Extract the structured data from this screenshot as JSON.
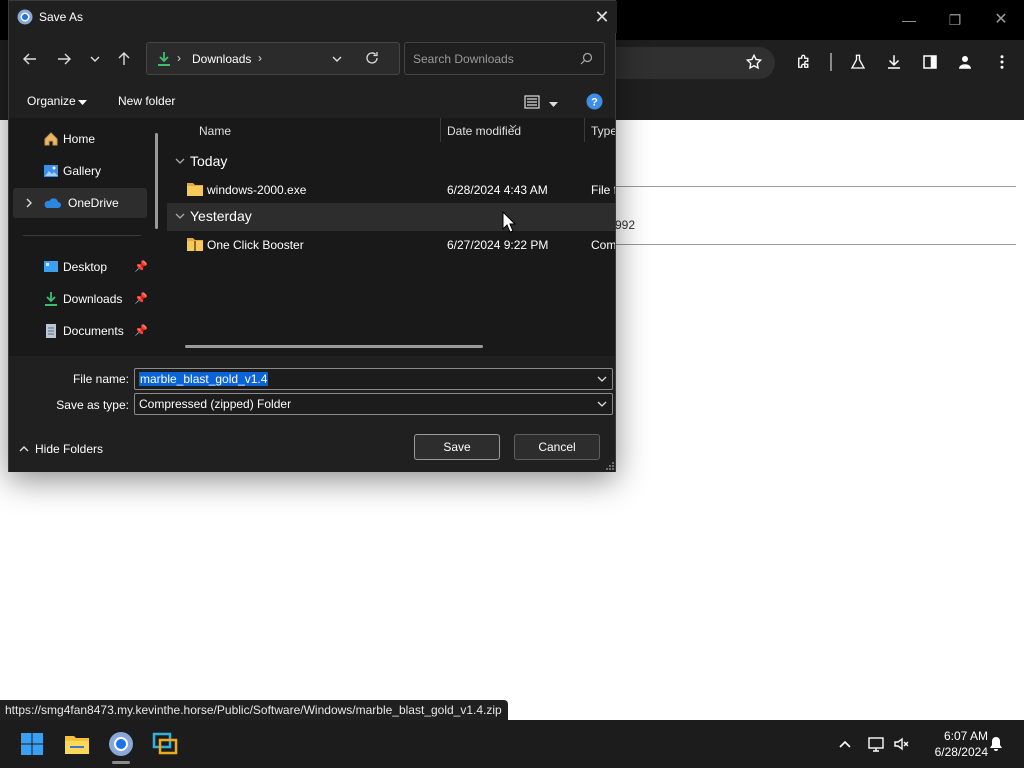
{
  "browser": {
    "status_url": "https://smg4fan8473.my.kevinthe.horse/Public/Software/Windows/marble_blast_gold_v1.4.zip",
    "page_partial_text": "992",
    "toolbar_icons": [
      "star-icon",
      "extensions-icon",
      "labs-icon",
      "download-icon",
      "sidepanel-icon",
      "profile-icon",
      "more-icon"
    ]
  },
  "dialog": {
    "title": "Save As",
    "address": {
      "location": "Downloads"
    },
    "search": {
      "placeholder": "Search Downloads"
    },
    "commands": {
      "organize": "Organize",
      "new_folder": "New folder"
    },
    "nav_pane": {
      "items": [
        {
          "label": "Home",
          "icon": "home-icon"
        },
        {
          "label": "Gallery",
          "icon": "gallery-icon"
        },
        {
          "label": "OneDrive",
          "icon": "onedrive-icon",
          "selected": true
        },
        {
          "label": "Desktop",
          "icon": "desktop-icon",
          "pinned": true
        },
        {
          "label": "Downloads",
          "icon": "downloads-icon",
          "pinned": true
        },
        {
          "label": "Documents",
          "icon": "documents-icon",
          "pinned": true
        }
      ]
    },
    "columns": {
      "name": "Name",
      "date": "Date modified",
      "type": "Type"
    },
    "groups": [
      {
        "label": "Today",
        "files": [
          {
            "name": "windows-2000.exe",
            "date": "6/28/2024 4:43 AM",
            "type": "File fo"
          }
        ]
      },
      {
        "label": "Yesterday",
        "files": [
          {
            "name": "One Click Booster",
            "date": "6/27/2024 9:22 PM",
            "type": "Com"
          }
        ]
      }
    ],
    "file_name_label": "File name:",
    "file_name_value": "marble_blast_gold_v1.4",
    "save_type_label": "Save as type:",
    "save_type_value": "Compressed (zipped) Folder",
    "hide_folders": "Hide Folders",
    "save": "Save",
    "cancel": "Cancel",
    "colors": {
      "selection": "#0a64d8",
      "help": "#3d8ee6"
    }
  },
  "taskbar": {
    "apps": [
      "windows-start-icon",
      "file-explorer-icon",
      "chrome-icon",
      "remote-desktop-icon"
    ],
    "time": "6:07 AM",
    "date": "6/28/2024"
  }
}
